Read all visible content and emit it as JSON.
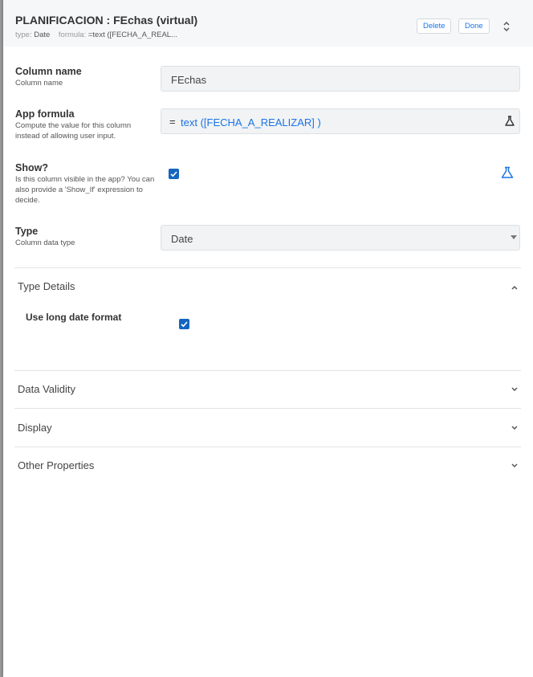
{
  "header": {
    "title": "PLANIFICACION : FEchas (virtual)",
    "type_key": "type:",
    "type_value": "Date",
    "formula_key": "formula:",
    "formula_value": "=text ([FECHA_A_REAL...",
    "delete_label": "Delete",
    "done_label": "Done"
  },
  "fields": {
    "column_name": {
      "label": "Column name",
      "description": "Column name",
      "value": "FEchas"
    },
    "app_formula": {
      "label": "App formula",
      "description": "Compute the value for this column instead of allowing user input.",
      "eq": "=",
      "value": "text ([FECHA_A_REALIZAR] )"
    },
    "show": {
      "label": "Show?",
      "description": "Is this column visible in the app? You can also provide a 'Show_If' expression to decide.",
      "checked": true
    },
    "type": {
      "label": "Type",
      "description": "Column data type",
      "value": "Date"
    }
  },
  "sections": {
    "type_details": {
      "title": "Type Details",
      "expanded": true,
      "long_date_label": "Use long date format",
      "long_date_checked": true
    },
    "data_validity": {
      "title": "Data Validity",
      "expanded": false
    },
    "display": {
      "title": "Display",
      "expanded": false
    },
    "other_properties": {
      "title": "Other Properties",
      "expanded": false
    }
  },
  "icons": [
    "expand-collapse-icon",
    "flask-icon",
    "checkbox-checked-icon",
    "dropdown-caret-icon",
    "chevron-up-icon",
    "chevron-down-icon"
  ],
  "colors": {
    "accent": "#1a73e8",
    "checkbox": "#1565c0",
    "header_bg": "#f6f7f9",
    "field_bg": "#f1f3f4"
  }
}
